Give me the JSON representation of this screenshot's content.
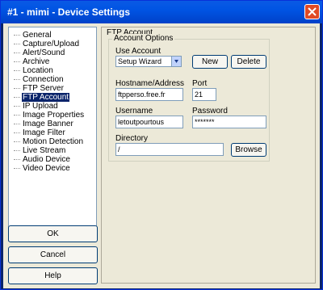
{
  "window": {
    "title": "#1 - mimi - Device Settings"
  },
  "tree": {
    "items": [
      "General",
      "Capture/Upload",
      "Alert/Sound",
      "Archive",
      "Location",
      "Connection",
      "FTP Server",
      "FTP Account",
      "IP Upload",
      "Image Properties",
      "Image Banner",
      "Image Filter",
      "Motion Detection",
      "Live Stream",
      "Audio Device",
      "Video Device"
    ],
    "selected": "FTP Account"
  },
  "buttons": {
    "ok": "OK",
    "cancel": "Cancel",
    "help": "Help"
  },
  "panel": {
    "title": "FTP Account",
    "group_title": "Account Options",
    "use_account_label": "Use Account",
    "use_account_value": "Setup Wizard",
    "new_label": "New",
    "delete_label": "Delete",
    "hostname_label": "Hostname/Address",
    "hostname_value": "ftpperso.free.fr",
    "port_label": "Port",
    "port_value": "21",
    "username_label": "Username",
    "username_value": "letoutpourtous",
    "password_label": "Password",
    "password_value": "*******",
    "directory_label": "Directory",
    "directory_value": "/",
    "browse_label": "Browse"
  },
  "colors": {
    "titlebar": "#0054e3",
    "selection": "#0a246a",
    "face": "#ece9d8"
  }
}
